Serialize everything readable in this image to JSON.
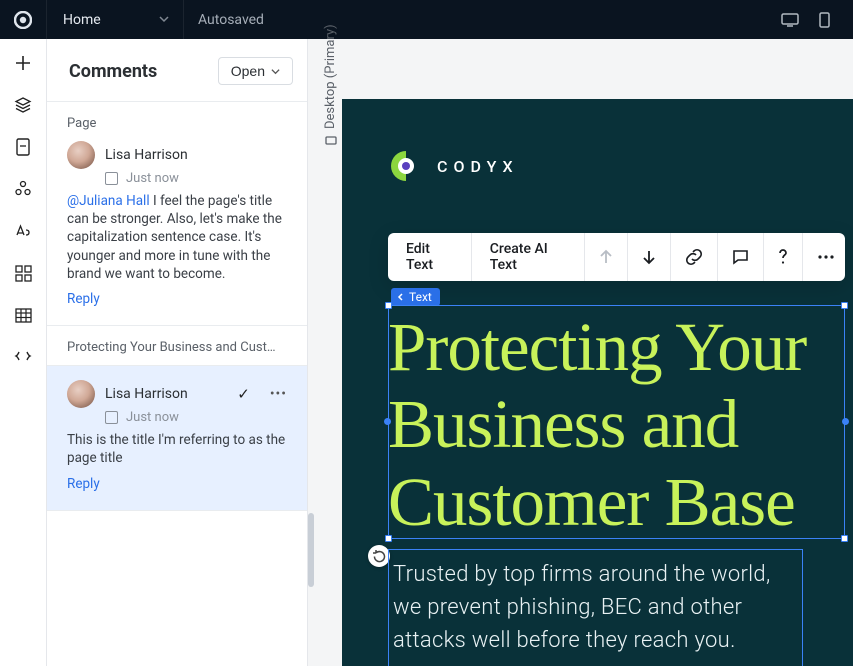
{
  "topbar": {
    "home_label": "Home",
    "status": "Autosaved"
  },
  "sidebar": {
    "title": "Comments",
    "filter_label": "Open"
  },
  "threads": [
    {
      "section": "Page",
      "author": "Lisa Harrison",
      "time": "Just now",
      "mention": "@Juliana Hall",
      "body": "I feel the page's title can be stronger. Also, let's make the capitalization sentence case. It's younger and more in tune with the brand we want to become.",
      "reply": "Reply"
    },
    {
      "section": "Protecting Your Business and Cust…",
      "author": "Lisa Harrison",
      "time": "Just now",
      "body": "This is the title I'm referring to as the page title",
      "reply": "Reply"
    }
  ],
  "viewport_label": "Desktop (Primary)",
  "brand": "CODYX",
  "toolbar": {
    "edit": "Edit Text",
    "ai": "Create AI Text"
  },
  "selection_chip": "Text",
  "hero": {
    "title": "Protecting Your Business and Customer Base",
    "sub": "Trusted by top firms around the world, we prevent phishing, BEC and other attacks well before they reach you."
  }
}
